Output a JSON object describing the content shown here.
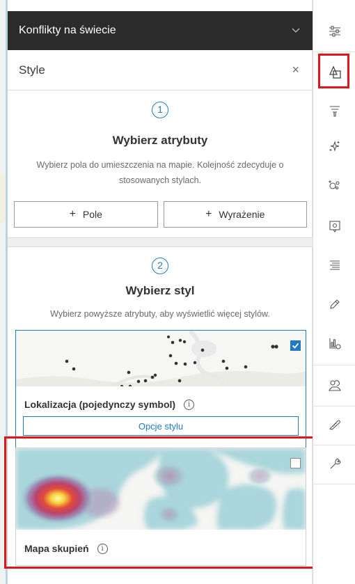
{
  "layer_header": {
    "title": "Konflikty na świecie",
    "chevron": "chevron-down-icon"
  },
  "style_panel": {
    "title": "Style",
    "close_label": "×",
    "step1": {
      "number": "1",
      "title": "Wybierz atrybuty",
      "description": "Wybierz pola do umieszczenia na mapie. Kolejność zdecyduje o stosowanych stylach.",
      "field_button": {
        "plus": "+",
        "label": "Pole"
      },
      "expression_button": {
        "plus": "+",
        "label": "Wyrażenie"
      }
    },
    "step2": {
      "number": "2",
      "title": "Wybierz styl",
      "description": "Wybierz powyższe atrybuty, aby wyświetlić więcej stylów."
    },
    "styles": [
      {
        "label": "Lokalizacja (pojedynczy symbol)",
        "selected": true,
        "options_label": "Opcje stylu"
      },
      {
        "label": "Mapa skupień",
        "selected": false
      }
    ]
  },
  "toolbar": {
    "tools": [
      {
        "name": "properties-icon"
      },
      {
        "name": "styles-icon",
        "active": true
      },
      {
        "name": "filter-icon"
      },
      {
        "name": "effects-icon"
      },
      {
        "name": "clustering-icon"
      },
      {
        "name": "popups-icon"
      },
      {
        "name": "labels-icon"
      },
      {
        "name": "edit-icon"
      },
      {
        "name": "charts-icon"
      },
      {
        "name": "sketch-icon"
      },
      {
        "name": "measure-icon"
      },
      {
        "name": "configure-icon"
      }
    ]
  },
  "colors": {
    "header_bg": "#2b2b2b",
    "accent_blue": "#1e7bc2",
    "highlight_red": "#e0161c",
    "checkbox_checked": "#1e7bc2"
  }
}
